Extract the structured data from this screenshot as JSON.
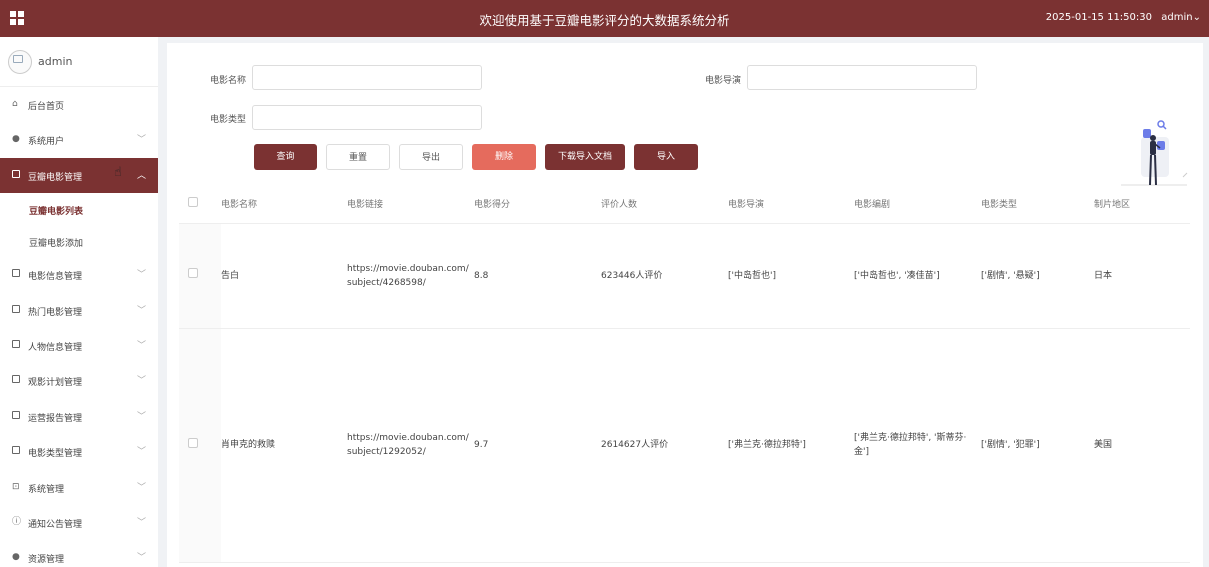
{
  "header": {
    "title": "欢迎使用基于豆瓣电影评分的大数据系统分析",
    "datetime": "2025-01-15 11:50:30",
    "user": "admin⌄"
  },
  "sidebar": {
    "username": "admin",
    "items": [
      {
        "label": "后台首页",
        "icon": "home-icon"
      },
      {
        "label": "系统用户",
        "icon": "user-icon"
      },
      {
        "label": "豆瓣电影管理",
        "icon": "box-icon",
        "active": true
      },
      {
        "label": "电影信息管理",
        "icon": "box-icon"
      },
      {
        "label": "热门电影管理",
        "icon": "box-icon"
      },
      {
        "label": "人物信息管理",
        "icon": "box-icon"
      },
      {
        "label": "观影计划管理",
        "icon": "box-icon"
      },
      {
        "label": "运营报告管理",
        "icon": "box-icon"
      },
      {
        "label": "电影类型管理",
        "icon": "box-icon"
      },
      {
        "label": "系统管理",
        "icon": "chart-icon"
      },
      {
        "label": "通知公告管理",
        "icon": "info-icon"
      },
      {
        "label": "资源管理",
        "icon": "bulb-icon"
      }
    ],
    "subitems": [
      {
        "label": "豆瓣电影列表",
        "active": true
      },
      {
        "label": "豆瓣电影添加"
      }
    ]
  },
  "filters": {
    "name_label": "电影名称",
    "director_label": "电影导演",
    "type_label": "电影类型"
  },
  "buttons": {
    "query": "查询",
    "reset": "重置",
    "export": "导出",
    "delete": "删除",
    "download_template": "下载导入文档",
    "import": "导入"
  },
  "table": {
    "headers": [
      "电影名称",
      "电影链接",
      "电影得分",
      "评价人数",
      "电影导演",
      "电影编剧",
      "电影类型",
      "制片地区"
    ],
    "rows": [
      {
        "name": "告白",
        "link1": "https://movie.douban.com/",
        "link2": "subject/4268598/",
        "score": "8.8",
        "votes": "623446人评价",
        "director": "['中岛哲也']",
        "writer1": "['中岛哲也', '凑佳苗']",
        "writer2": "",
        "genre": "['剧情', '悬疑']",
        "region": "日本"
      },
      {
        "name": "肖申克的救赎",
        "link1": "https://movie.douban.com/",
        "link2": "subject/1292052/",
        "score": "9.7",
        "votes": "2614627人评价",
        "director": "['弗兰克·德拉邦特']",
        "writer1": "['弗兰克·德拉邦特', '斯蒂芬·",
        "writer2": "金']",
        "genre": "['剧情', '犯罪']",
        "region": "美国"
      }
    ]
  },
  "colors": {
    "brand": "#7b3232",
    "danger": "#e56b5d"
  }
}
